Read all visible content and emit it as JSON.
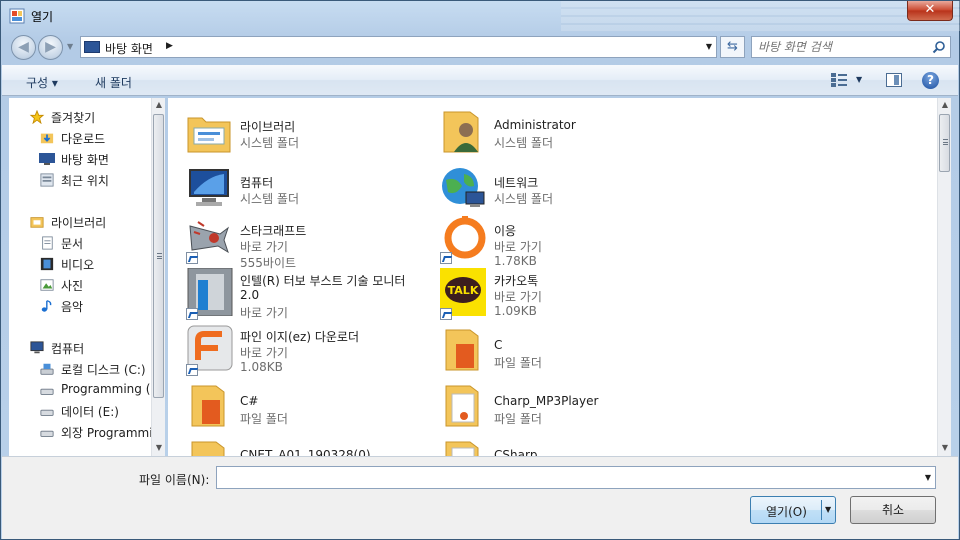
{
  "window": {
    "title": "열기",
    "close": "✕"
  },
  "nav": {
    "back": "◀",
    "forward": "▶"
  },
  "address": {
    "location": "바탕 화면"
  },
  "search": {
    "placeholder": "바탕 화면 검색"
  },
  "toolbar": {
    "organize": "구성 ▾",
    "new_folder": "새 폴더",
    "help": "?"
  },
  "sidebar": {
    "favorites": {
      "label": "즐겨찾기",
      "items": [
        "다운로드",
        "바탕 화면",
        "최근 위치"
      ]
    },
    "libraries": {
      "label": "라이브러리",
      "items": [
        "문서",
        "비디오",
        "사진",
        "음악"
      ]
    },
    "computer": {
      "label": "컴퓨터",
      "items": [
        "로컬 디스크 (C:)",
        "Programming (D",
        "데이터 (E:)",
        "외장 Programmi"
      ]
    }
  },
  "files": [
    {
      "name": "라이브러리",
      "sub": "시스템 폴더",
      "icon": "library-icon"
    },
    {
      "name": "Administrator",
      "sub": "시스템 폴더",
      "icon": "user-folder-icon"
    },
    {
      "name": "컴퓨터",
      "sub": "시스템 폴더",
      "icon": "computer-icon"
    },
    {
      "name": "네트워크",
      "sub": "시스템 폴더",
      "icon": "network-icon"
    },
    {
      "name": "스타크래프트",
      "sub": "바로 가기",
      "size": "555바이트",
      "icon": "starcraft-shortcut-icon"
    },
    {
      "name": "이응",
      "sub": "바로 가기",
      "size": "1.78KB",
      "icon": "ieung-shortcut-icon"
    },
    {
      "name": "인텔(R) 터보 부스트 기술 모니터",
      "name2": "2.0",
      "sub": "바로 가기",
      "icon": "intel-turbo-shortcut-icon"
    },
    {
      "name": "카카오톡",
      "sub": "바로 가기",
      "size": "1.09KB",
      "icon": "kakaotalk-shortcut-icon",
      "badge": "TALK"
    },
    {
      "name": "파인 이지(ez) 다운로더",
      "sub": "바로 가기",
      "size": "1.08KB",
      "icon": "fine-ez-shortcut-icon"
    },
    {
      "name": "C",
      "sub": "파일 폴더",
      "icon": "folder-icon"
    },
    {
      "name": "C#",
      "sub": "파일 폴더",
      "icon": "folder-icon"
    },
    {
      "name": "Charp_MP3Player",
      "sub": "파일 폴더",
      "icon": "folder-icon"
    },
    {
      "name": "CNET_A01_190328(0)",
      "icon": "folder-icon"
    },
    {
      "name": "CSharp",
      "icon": "folder-icon"
    }
  ],
  "footer": {
    "filename_label": "파일 이름(N):",
    "filename_value": "",
    "open_label": "열기(O)",
    "cancel_label": "취소"
  },
  "colors": {
    "accent": "#3c7fb1",
    "folder": "#f3c55a",
    "kakao": "#fae100"
  }
}
